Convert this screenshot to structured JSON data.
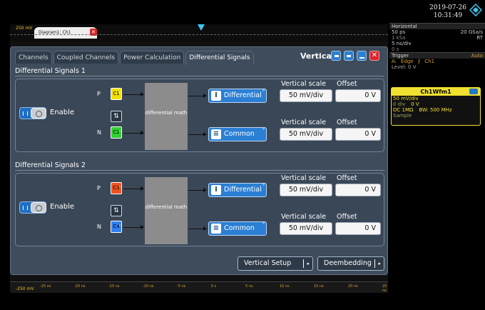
{
  "statusbar": {
    "date": "2019-07-26",
    "time": "10:31:49"
  },
  "diagram": {
    "scale_label": "250 mV",
    "tab_label": "Diagram1: Ch1",
    "close_glyph": "✕",
    "xaxis_left": "-250 mV",
    "xaxis_ticks": [
      "-25 ns",
      "-20 ns",
      "-15 ns",
      "-10 ns",
      "-5 ns",
      "0 s",
      "5 ns",
      "10 ns",
      "15 ns",
      "20 ns",
      "25 ns"
    ]
  },
  "horizontal": {
    "title": "Horizontal",
    "time_scale": "50 ps",
    "sample_rate": "20 GSa/s",
    "record": "1 kSa",
    "mode": "RT",
    "res": "5 ns/div",
    "pos": "0 s"
  },
  "trigger": {
    "title": "Trigger",
    "mode": "Auto",
    "source_letter": "A:",
    "type": "Edge",
    "edge_glyph": "⨍",
    "channel": "Ch1",
    "level": "Level: 0 V"
  },
  "channel_card": {
    "title": "Ch1Wfm1",
    "scale": "50 mV/div",
    "offset_label": "0 div",
    "offset_value": "0 V",
    "coupling": "DC 1MΩ",
    "bandwidth": "BW: 500 MHz",
    "acq": "Sample",
    "color": "#f0e030"
  },
  "dialog": {
    "title": "Vertical",
    "tabs": [
      "Channels",
      "Coupled Channels",
      "Power Calculation",
      "Differential Signals"
    ],
    "active_tab": 3,
    "sections": [
      {
        "title": "Differential Signals 1",
        "enable_label": "Enable",
        "p_label": "P",
        "n_label": "N",
        "p_channel": "C1",
        "n_channel": "C2",
        "p_color": "#f0e000",
        "n_color": "#30d030",
        "swap_glyph": "⇅",
        "math_label": "differential math",
        "outputs": [
          {
            "label": "Differential",
            "scale": "50 mV/div",
            "offset": "0 V"
          },
          {
            "label": "Common",
            "scale": "50 mV/div",
            "offset": "0 V"
          }
        ],
        "scale_label": "Vertical scale",
        "offset_label": "Offset"
      },
      {
        "title": "Differential Signals 2",
        "enable_label": "Enable",
        "p_label": "P",
        "n_label": "N",
        "p_channel": "C3",
        "n_channel": "C4",
        "p_color": "#f05020",
        "n_color": "#2f7ff0",
        "swap_glyph": "⇅",
        "math_label": "differential math",
        "outputs": [
          {
            "label": "Differential",
            "scale": "50 mV/div",
            "offset": "0 V"
          },
          {
            "label": "Common",
            "scale": "50 mV/div",
            "offset": "0 V"
          }
        ],
        "scale_label": "Vertical scale",
        "offset_label": "Offset"
      }
    ],
    "buttons": {
      "vertical_setup": "Vertical Setup",
      "deembedding": "Deembedding"
    }
  },
  "colors": {
    "accent": "#2b7fd4",
    "panel": "#3e4c5c",
    "close": "#d9262c"
  }
}
